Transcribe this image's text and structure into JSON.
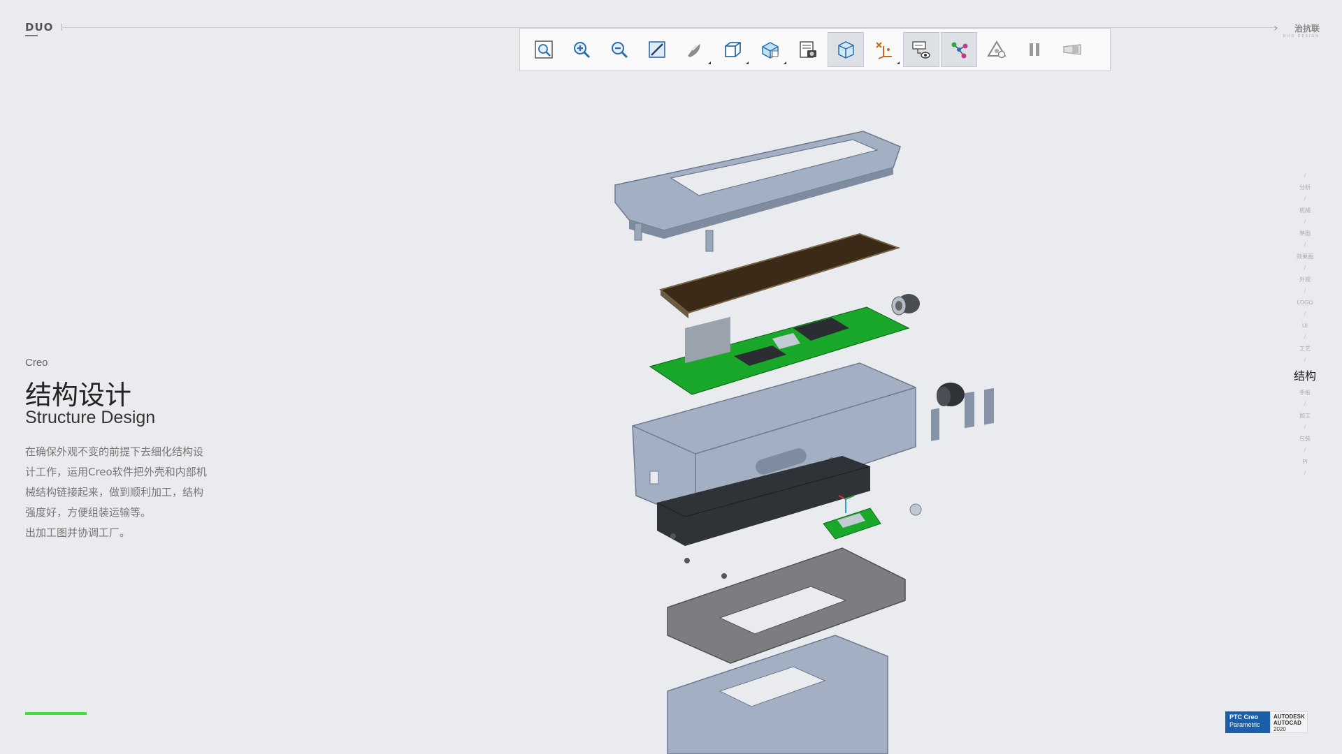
{
  "header": {
    "logo": "DUO",
    "brand": "治抗联",
    "brand_sub": "DUO DESIGN"
  },
  "toolbar": {
    "buttons": [
      {
        "icon": "zoom-fit-icon",
        "active": false,
        "dropdown": false
      },
      {
        "icon": "zoom-in-icon",
        "active": false,
        "dropdown": false
      },
      {
        "icon": "zoom-out-icon",
        "active": false,
        "dropdown": false
      },
      {
        "icon": "repaint-icon",
        "active": false,
        "dropdown": false
      },
      {
        "icon": "display-style-icon",
        "active": false,
        "dropdown": true
      },
      {
        "icon": "saved-orientations-icon",
        "active": false,
        "dropdown": true
      },
      {
        "icon": "view-manager-icon",
        "active": false,
        "dropdown": true
      },
      {
        "icon": "appearance-gallery-icon",
        "active": false,
        "dropdown": false
      },
      {
        "icon": "perspective-view-icon",
        "active": true,
        "dropdown": false
      },
      {
        "icon": "datum-display-icon",
        "active": false,
        "dropdown": true
      },
      {
        "icon": "annotation-display-icon",
        "active": true,
        "dropdown": false
      },
      {
        "icon": "explode-view-icon",
        "active": true,
        "dropdown": false
      },
      {
        "icon": "spin-center-icon",
        "active": false,
        "dropdown": false
      },
      {
        "icon": "pause-icon",
        "active": false,
        "dropdown": false
      },
      {
        "icon": "flatten-view-icon",
        "active": false,
        "dropdown": false
      }
    ]
  },
  "intro": {
    "tool": "Creo",
    "title_cn": "结构设计",
    "title_en": "Structure Design",
    "paragraph1": "在确保外观不变的前提下去细化结构设计工作，运用Creo软件把外壳和内部机械结构链接起来，做到顺利加工，结构强度好，方便组装运输等。",
    "paragraph2": "出加工图并协调工厂。"
  },
  "right_nav": {
    "items": [
      "分析",
      "机械",
      "草图",
      "效果图",
      "外观",
      "LOGO",
      "UI",
      "工艺",
      "结构",
      "手板",
      "加工",
      "包装",
      "PI"
    ],
    "active": "结构"
  },
  "badges": {
    "ptc_line1": "PTC Creo",
    "ptc_line2": "Parametric",
    "ad_line1": "AUTODESK",
    "ad_line2": "AUTOCAD",
    "ad_line3": "2020"
  },
  "colors": {
    "background": "#e9ebee",
    "accent_green": "#3ee03a",
    "pcb_green": "#1aa82a",
    "metal": "#9aa7bb",
    "screen": "#3b2a18"
  }
}
